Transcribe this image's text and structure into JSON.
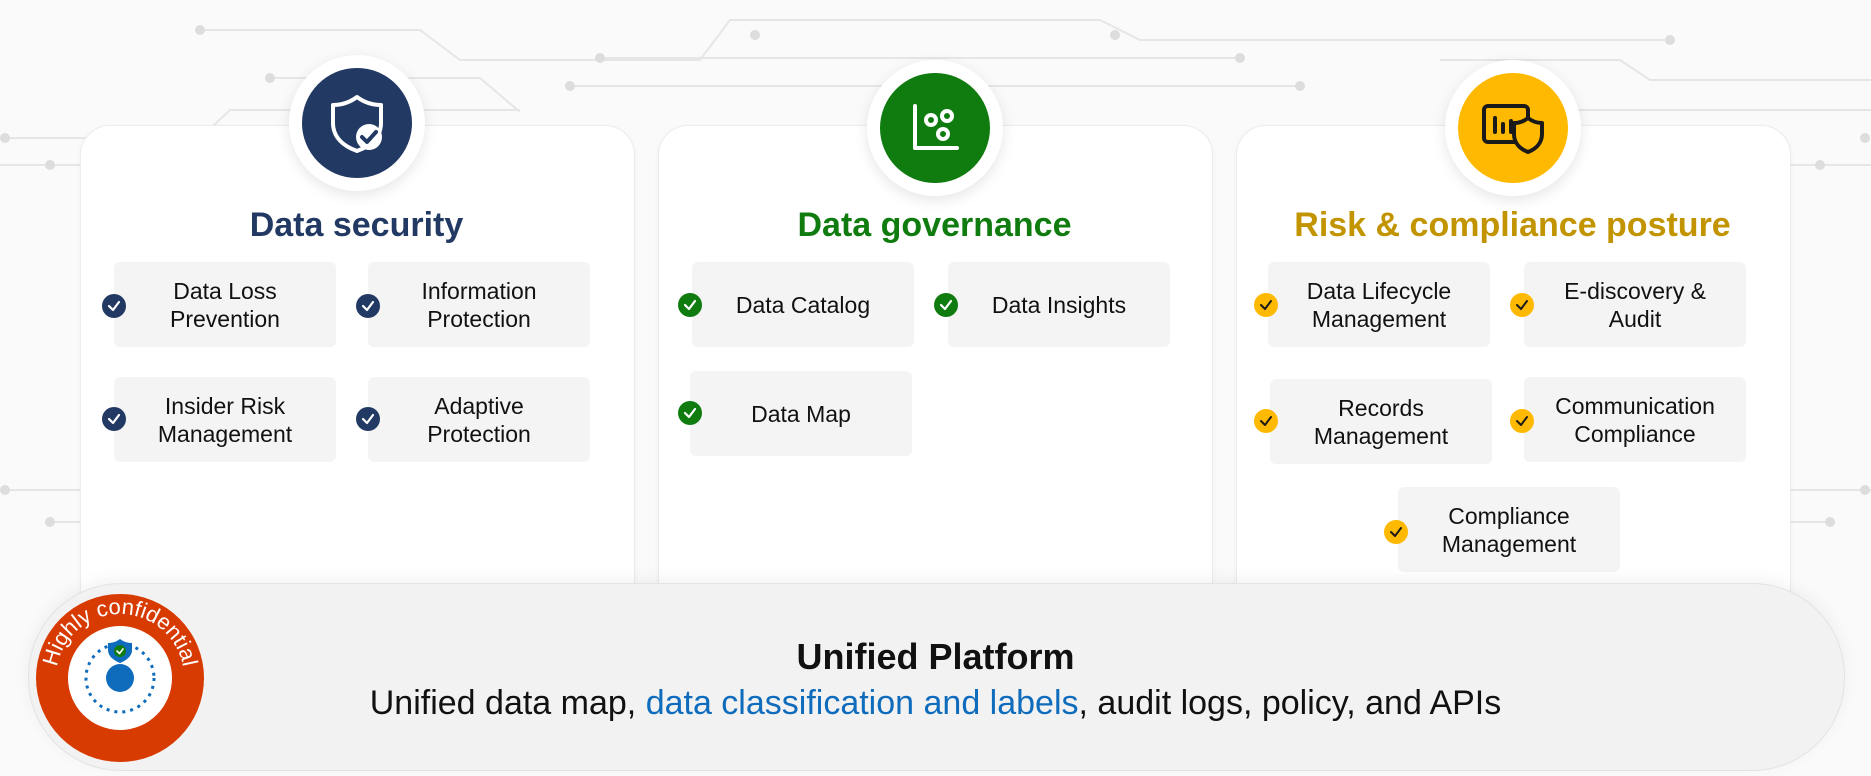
{
  "colors": {
    "security": "#223a63",
    "governance": "#107c10",
    "risk": "#ffb900",
    "risk_title": "#c29400",
    "highlight": "#0f6cbd",
    "label_badge": "#d83b01"
  },
  "cards": {
    "security": {
      "title": "Data security",
      "icon": "shield-check-icon",
      "items": [
        {
          "label": "Data Loss Prevention"
        },
        {
          "label": "Information Protection"
        },
        {
          "label": "Insider Risk Management"
        },
        {
          "label": "Adaptive Protection"
        }
      ]
    },
    "governance": {
      "title": "Data governance",
      "icon": "chart-dots-icon",
      "items": [
        {
          "label": "Data Catalog"
        },
        {
          "label": "Data Insights"
        },
        {
          "label": "Data Map"
        }
      ]
    },
    "risk": {
      "title": "Risk & compliance posture",
      "icon": "dashboard-shield-icon",
      "items": [
        {
          "label": "Data Lifecycle Management"
        },
        {
          "label": "E-discovery & Audit"
        },
        {
          "label": "Records Management"
        },
        {
          "label": "Communication Compliance"
        },
        {
          "label": "Compliance Management"
        }
      ]
    }
  },
  "platform": {
    "title": "Unified Platform",
    "desc_before": "Unified data map, ",
    "desc_highlight": "data classification and labels",
    "desc_after": ", audit logs, policy, and APIs"
  },
  "label_badge": {
    "text": "Highly confidential",
    "icon": "sensitivity-label-icon"
  }
}
